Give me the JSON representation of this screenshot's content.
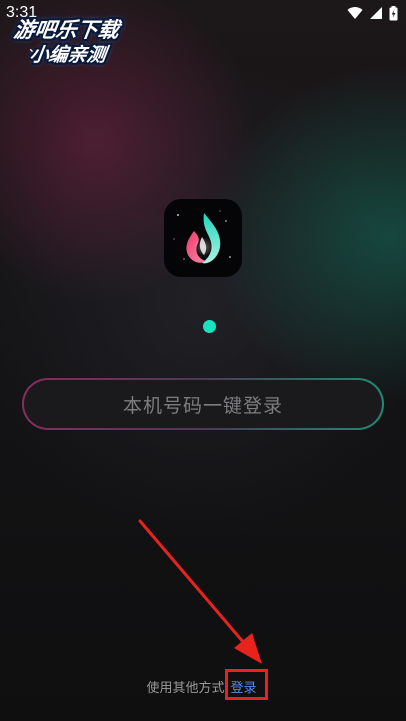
{
  "status_bar": {
    "time": "3:31",
    "icons": [
      "notification-icon",
      "wifi-icon",
      "cell-signal-icon",
      "battery-icon"
    ]
  },
  "watermark": {
    "line1": "游吧乐下载",
    "line2": "小编亲测"
  },
  "app": {
    "logo_icon": "flame-logo-icon"
  },
  "login": {
    "one_click_label": "本机号码一键登录",
    "alt_prefix": "使用其他方式",
    "alt_link": "登录"
  },
  "colors": {
    "accent_teal": "#18e3bf",
    "link_blue": "#5b86e6",
    "annotation_red": "#e8231e"
  }
}
